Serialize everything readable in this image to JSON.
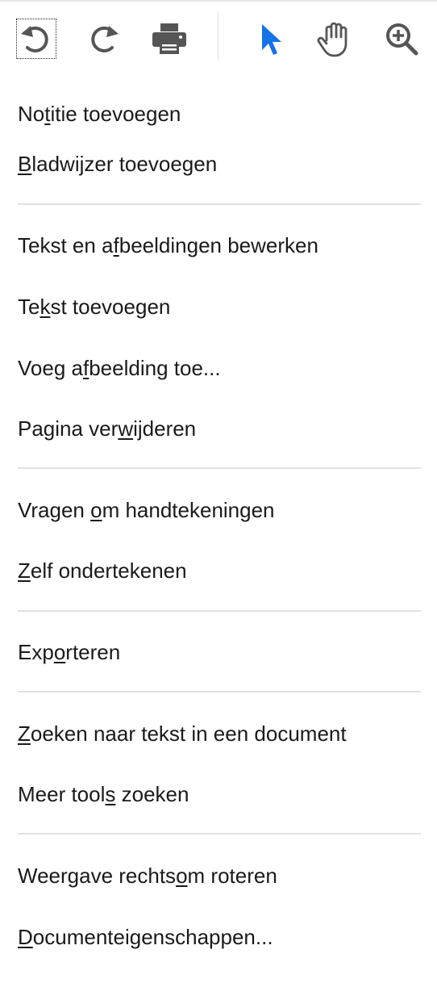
{
  "toolbar": {
    "tools": [
      {
        "icon": "rotate-left-icon",
        "tooltip": "Draai linksom"
      },
      {
        "icon": "rotate-right-icon",
        "tooltip": "Draai rechtsom"
      },
      {
        "icon": "print-icon",
        "tooltip": "Afdrukken"
      },
      {
        "icon": "select-pointer-icon",
        "tooltip": "Selecteren",
        "color": "#1473e6"
      },
      {
        "icon": "hand-icon",
        "tooltip": "Handje"
      },
      {
        "icon": "zoom-in-icon",
        "tooltip": "Inzoomen"
      }
    ]
  },
  "menu": {
    "items": [
      {
        "pre": "No",
        "key": "t",
        "post": "itie toevoegen"
      },
      {
        "pre": "",
        "key": "B",
        "post": "ladwijzer toevoegen"
      },
      {
        "pre": "Tekst en a",
        "key": "f",
        "post": "beeldingen bewerken"
      },
      {
        "pre": "Te",
        "key": "k",
        "post": "st toevoegen"
      },
      {
        "pre": "Voeg a",
        "key": "f",
        "post": "beelding toe..."
      },
      {
        "pre": "Pagina ver",
        "key": "w",
        "post": "ijderen"
      },
      {
        "pre": "Vragen ",
        "key": "o",
        "post": "m handtekeningen"
      },
      {
        "pre": "",
        "key": "Z",
        "post": "elf ondertekenen"
      },
      {
        "pre": "Exp",
        "key": "o",
        "post": "rteren"
      },
      {
        "pre": "",
        "key": "Z",
        "post": "oeken naar tekst in een document"
      },
      {
        "pre": "Meer tool",
        "key": "s",
        "post": " zoeken"
      },
      {
        "pre": "Weergave rechts",
        "key": "o",
        "post": "m roteren"
      },
      {
        "pre": "",
        "key": "D",
        "post": "ocumenteigenschappen..."
      }
    ]
  },
  "colors": {
    "icon": "#555555",
    "accent": "#1473e6",
    "separator": "#e1e1e1",
    "text": "#1a1a1a"
  }
}
